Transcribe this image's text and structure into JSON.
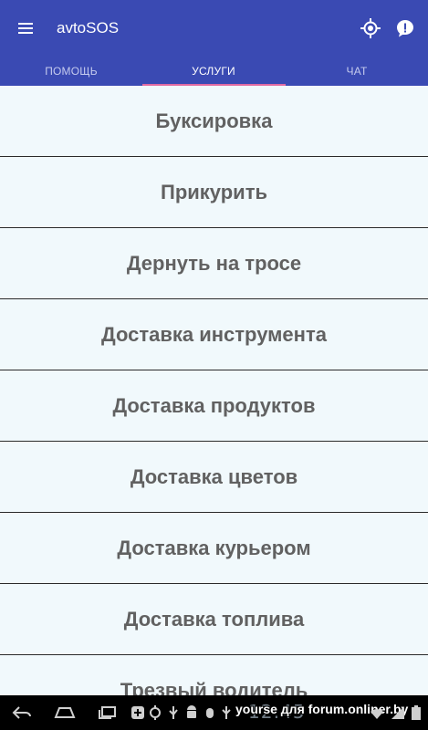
{
  "app": {
    "title": "avtoSOS",
    "colors": {
      "primary": "#3a4ab3",
      "accent": "#e06aa2",
      "list_background": "#eff8fb",
      "item_text": "#616161"
    }
  },
  "toolbar": {
    "menu_icon": "hamburger-menu-icon",
    "location_icon": "gps-location-icon",
    "alert_icon": "alert-bubble-icon"
  },
  "tabs": [
    {
      "label": "ПОМОЩЬ",
      "active": false
    },
    {
      "label": "УСЛУГИ",
      "active": true
    },
    {
      "label": "ЧАТ",
      "active": false
    }
  ],
  "services": [
    "Буксировка",
    "Прикурить",
    "Дернуть на тросе",
    "Доставка инструмента",
    "Доставка продуктов",
    "Доставка цветов",
    "Доставка курьером",
    "Доставка топлива",
    "Трезвый водитель"
  ],
  "navbar": {
    "watermark": "yourse для forum.onliner.by",
    "time": "12:45"
  }
}
